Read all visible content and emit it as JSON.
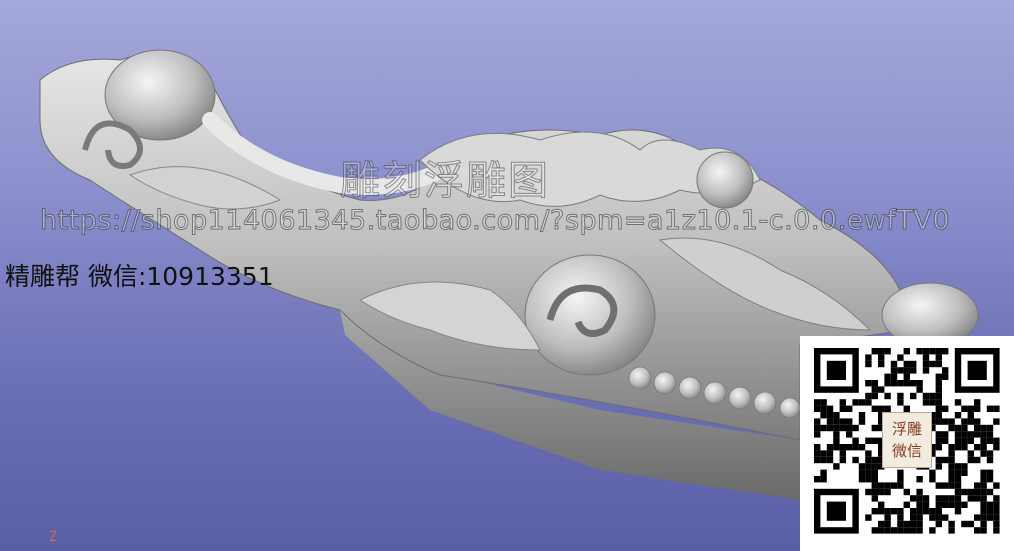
{
  "viewport": {
    "watermark_title": "雕刻浮雕图",
    "watermark_url": "https://shop114061345.taobao.com/?spm=a1z10.1-c.0.0.ewfTV0",
    "contact_text": "精雕帮 微信:10913351",
    "axis_label": "Z"
  },
  "qr": {
    "badge_line1": "浮雕",
    "badge_line2": "微信"
  },
  "colors": {
    "background_top": "#a4a8da",
    "background_bottom": "#5a5ea6",
    "model": "#c9c9c9",
    "axis": "#d8703a"
  }
}
